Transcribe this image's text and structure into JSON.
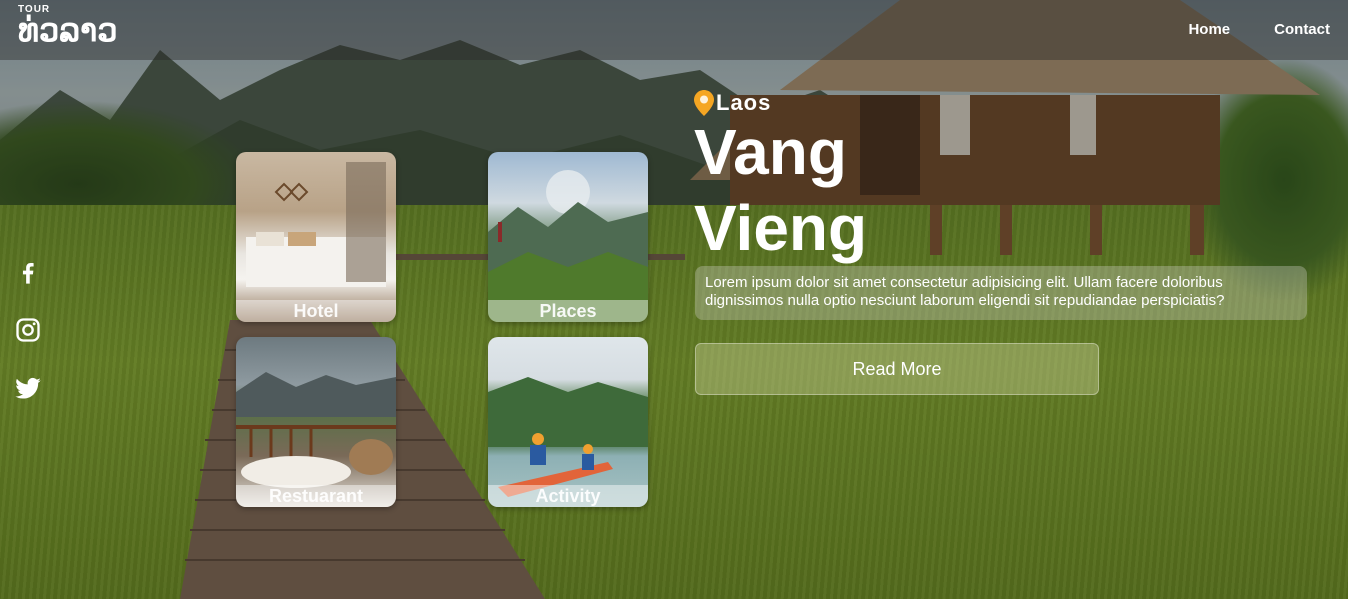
{
  "logo": {
    "small": "TOUR",
    "main": "ທ່ວລາວ"
  },
  "nav": {
    "home": "Home",
    "contact": "Contact"
  },
  "social": [
    "facebook-icon",
    "instagram-icon",
    "twitter-icon"
  ],
  "cards": {
    "hotel": "Hotel",
    "places": "Places",
    "restaurant": "Restuarant",
    "activity": "Activity"
  },
  "hero": {
    "location": "Laos",
    "title_line1": "Vang",
    "title_line2": "Vieng",
    "description": "Lorem ipsum dolor sit amet consectetur adipisicing elit. Ullam facere doloribus dignissimos nulla optio nesciunt laborum eligendi sit repudiandae perspiciatis?",
    "read_more": "Read More"
  },
  "colors": {
    "pin": "#f5a623",
    "text": "#ffffff"
  }
}
